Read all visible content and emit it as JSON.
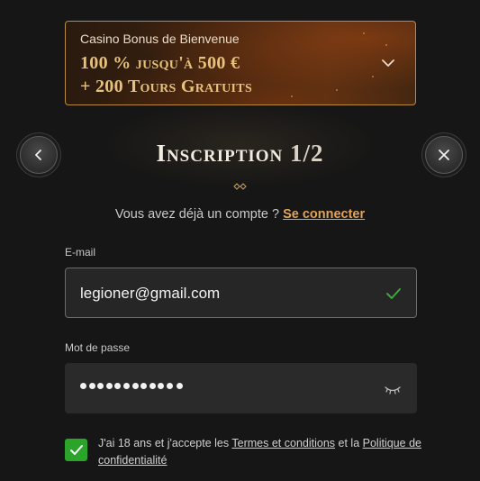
{
  "bonus": {
    "subtitle": "Casino Bonus de Bienvenue",
    "line1": "100 % jusqu'à 500 €",
    "line2": "+ 200 Tours Gratuits"
  },
  "header": {
    "title": "Inscription",
    "step": "1/2"
  },
  "login": {
    "prompt": "Vous avez déjà un compte ?",
    "link": "Se connecter"
  },
  "email": {
    "label": "E-mail",
    "value": "legioner@gmail.com"
  },
  "password": {
    "label": "Mot de passe",
    "masked_length": 11
  },
  "terms": {
    "text_before": "J'ai 18 ans et j'accepte les",
    "terms_link": "Termes et conditions",
    "and": "et la",
    "privacy_link": "Politique de confidentialité",
    "checked": true
  },
  "colors": {
    "accent_gold": "#e7c27a",
    "link_orange": "#e2a45a",
    "checkbox_green": "#2aa52a",
    "valid_green": "#3aa83a"
  }
}
